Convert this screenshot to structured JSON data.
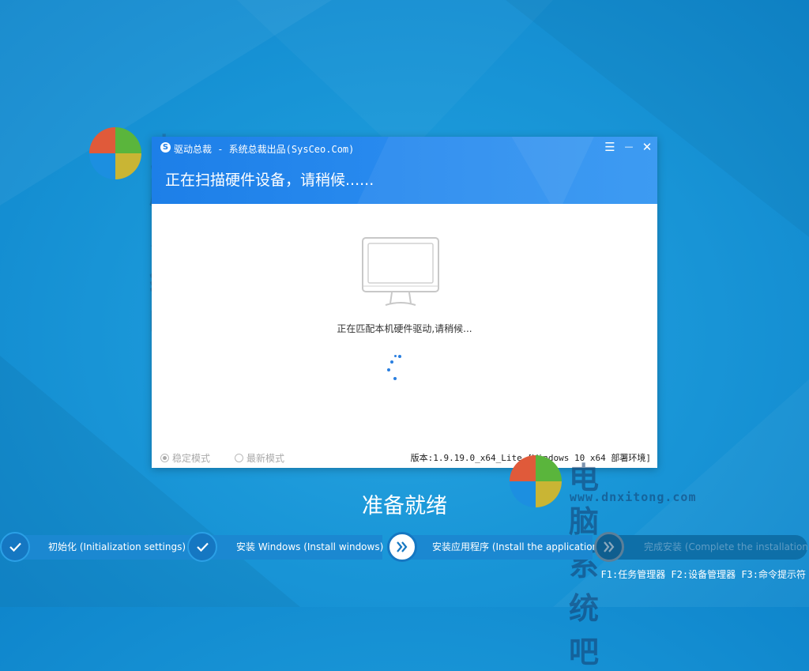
{
  "watermark": {
    "title": "电脑系统吧",
    "site": "www.dnxitong.com"
  },
  "window": {
    "title": "驱动总裁 - 系统总裁出品(SysCeo.Com)",
    "heading": "正在扫描硬件设备，请稍候......",
    "status": "正在匹配本机硬件驱动,请稍候...",
    "mode_stable": "稳定模式",
    "mode_latest": "最新模式",
    "version": "版本:1.9.19.0_x64_Lite [Windows 10 x64 部署环境]",
    "controls": {
      "menu": "☰",
      "minimize": "—",
      "close": "✕"
    }
  },
  "ready_text": "准备就绪",
  "steps": [
    {
      "label": "初始化 (Initialization settings)",
      "state": "done"
    },
    {
      "label": "安装 Windows (Install windows)",
      "state": "done"
    },
    {
      "label": "安装应用程序 (Install the application)",
      "state": "current"
    },
    {
      "label": "完成安装 (Complete the installation)",
      "state": "pending"
    }
  ],
  "function_keys": "F1:任务管理器 F2:设备管理器 F3:命令提示符",
  "colors": {
    "background": "#1a97d8",
    "header": "#2b8df0",
    "accent_blue": "#2a7fe0",
    "logo_red": "#e05a3a",
    "logo_green": "#5ab53c",
    "logo_blue": "#1c8fe0",
    "logo_yellow": "#c9b534"
  },
  "icons": [
    "app-logo-icon",
    "menu-icon",
    "minimize-icon",
    "close-icon",
    "monitor-icon",
    "loading-spinner-icon",
    "check-icon",
    "double-chevron-icon"
  ]
}
